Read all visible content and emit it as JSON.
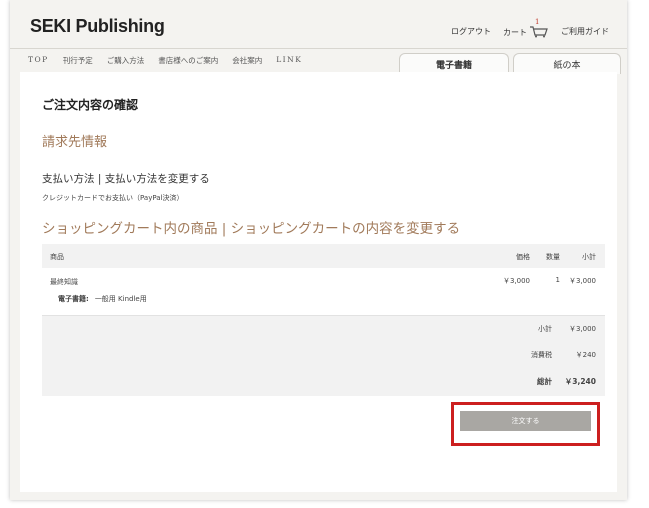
{
  "header": {
    "logo": "SEKI Publishing",
    "links": {
      "logout": "ログアウト",
      "cart": "カート",
      "cart_count": "1",
      "guide": "ご利用ガイド"
    }
  },
  "nav": {
    "items": [
      "TOP",
      "刊行予定",
      "ご購入方法",
      "書店様へのご案内",
      "会社案内",
      "LINK"
    ],
    "tabs": {
      "ebook": "電子書籍",
      "paper": "紙の本"
    }
  },
  "page": {
    "title": "ご注文内容の確認",
    "billing_heading": "請求先情報",
    "payment_heading": "支払い方法 | 支払い方法を変更する",
    "payment_method": "クレジットカードでお支払い（PayPal決済）",
    "cart_heading": "ショッピングカート内の商品 | ショッピングカートの内容を変更する"
  },
  "table": {
    "headers": {
      "product": "商品",
      "price": "価格",
      "qty": "数量",
      "subtotal": "小計"
    },
    "rows": [
      {
        "name": "最終知識",
        "format_label": "電子書籍:",
        "format_value": "一般用 Kindle用",
        "price": "￥3,000",
        "qty": "1",
        "subtotal": "￥3,000"
      }
    ],
    "totals": {
      "subtotal_label": "小計",
      "subtotal_value": "￥3,000",
      "tax_label": "消費税",
      "tax_value": "￥240",
      "total_label": "総計",
      "total_value": "￥3,240"
    }
  },
  "order_button": "注文する",
  "colors": {
    "accent_heading": "#a17a5a",
    "highlight_border": "#cc1f1f",
    "button_bg": "#a9a7a3"
  }
}
